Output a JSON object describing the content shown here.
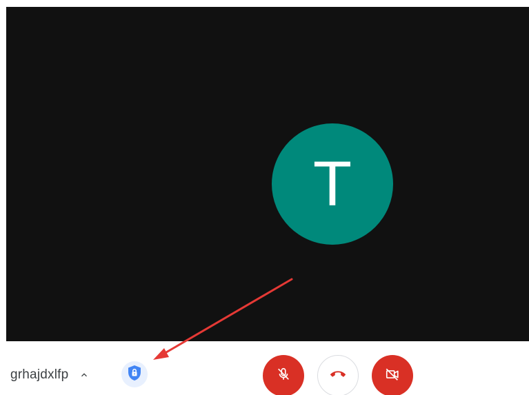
{
  "participant": {
    "initial": "T"
  },
  "meeting": {
    "code": "grhajdxlfp"
  },
  "controls": {
    "details_icon": "chevron-up-icon",
    "security_icon": "shield-lock-icon",
    "mic_icon": "mic-off-icon",
    "hangup_icon": "phone-hangup-icon",
    "camera_icon": "camera-off-icon"
  },
  "colors": {
    "video_background": "#111111",
    "avatar": "#00897b",
    "danger": "#d93025",
    "security_accent": "#4285f4",
    "annotation_arrow": "#e53935"
  }
}
